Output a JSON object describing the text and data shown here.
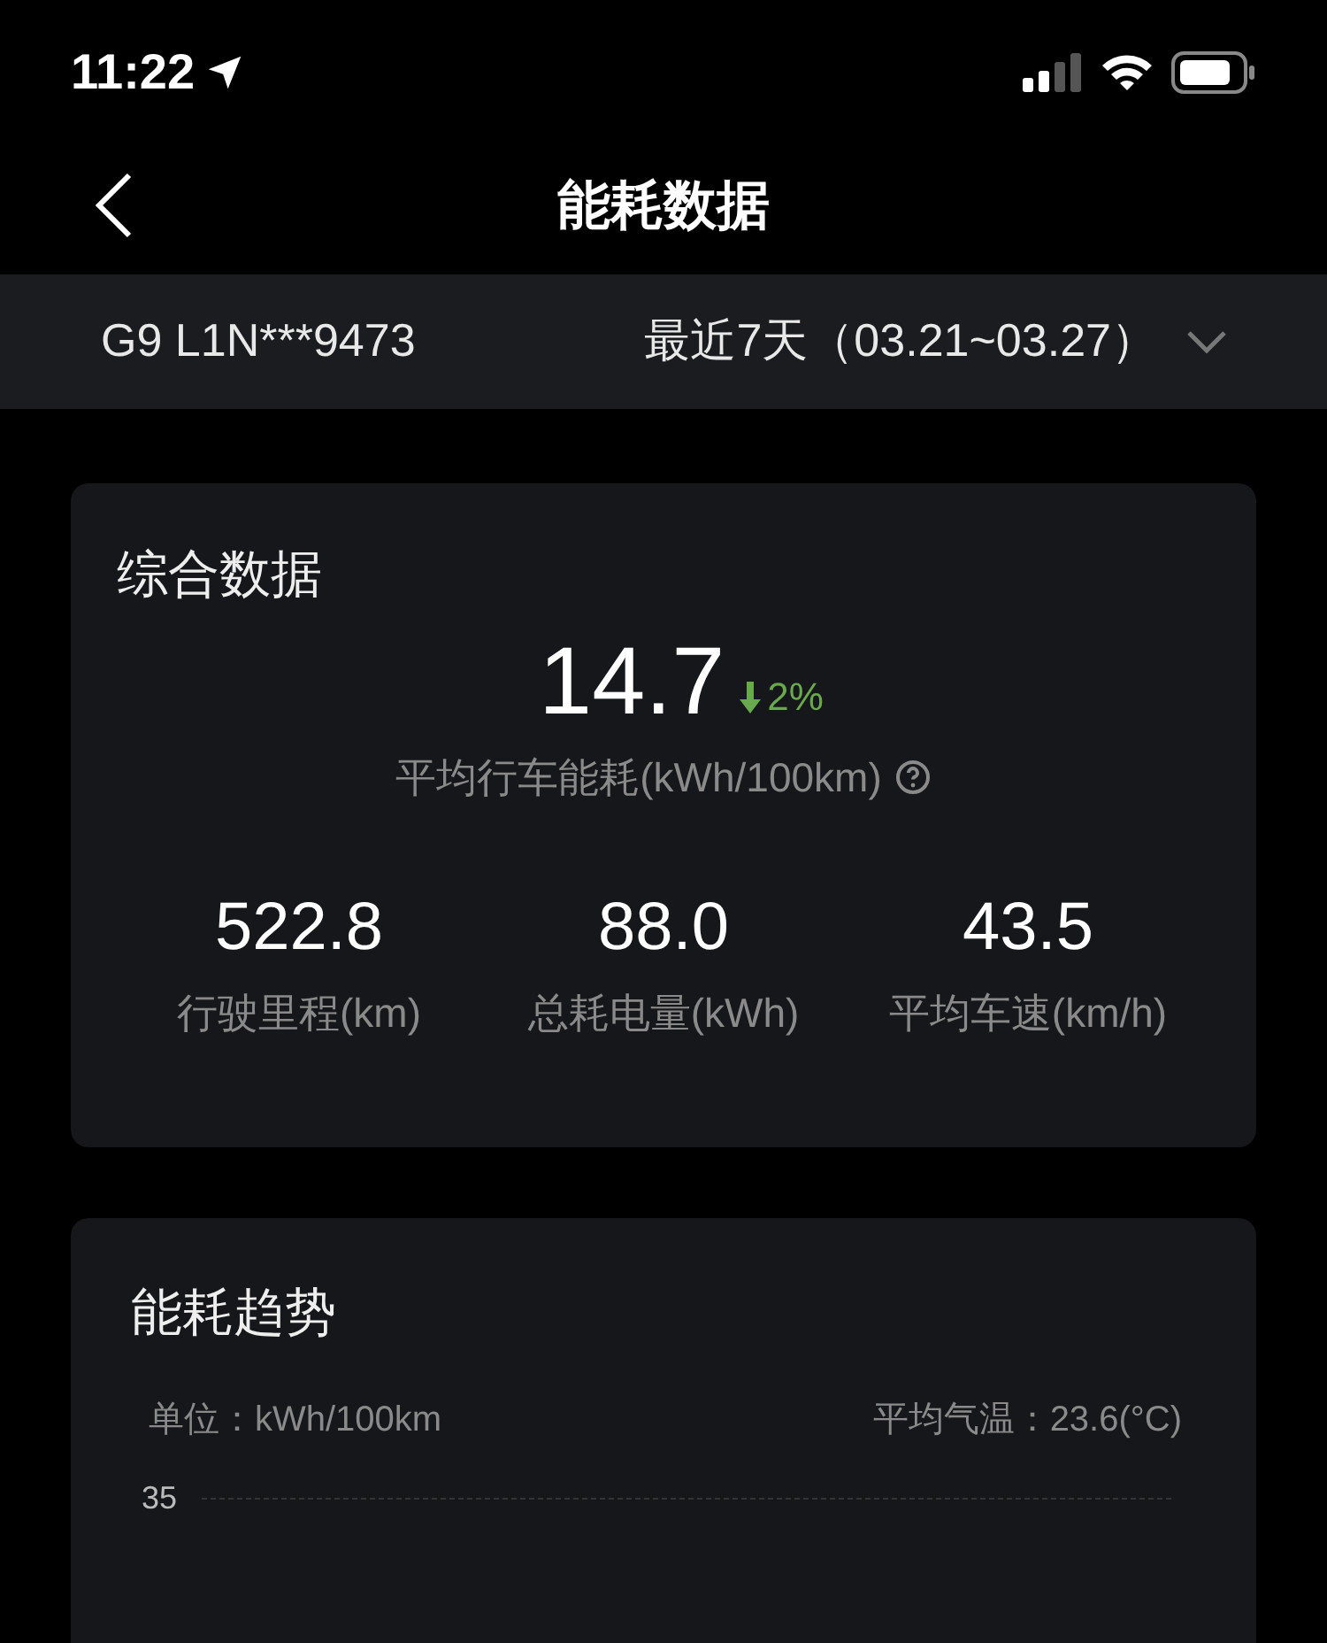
{
  "status_bar": {
    "time": "11:22"
  },
  "nav": {
    "title": "能耗数据"
  },
  "selector": {
    "vehicle": "G9 L1N***9473",
    "period": "最近7天（03.21~03.27）"
  },
  "summary": {
    "title": "综合数据",
    "main_value": "14.7",
    "change": {
      "decreased": true,
      "text": "2%"
    },
    "main_label": "平均行车能耗(kWh/100km)",
    "stats": [
      {
        "value": "522.8",
        "label": "行驶里程(km)"
      },
      {
        "value": "88.0",
        "label": "总耗电量(kWh)"
      },
      {
        "value": "43.5",
        "label": "平均车速(km/h)"
      }
    ]
  },
  "trend": {
    "title": "能耗趋势",
    "unit": "单位：kWh/100km",
    "temperature": "平均气温：23.6(°C)",
    "y_tick": "35"
  }
}
